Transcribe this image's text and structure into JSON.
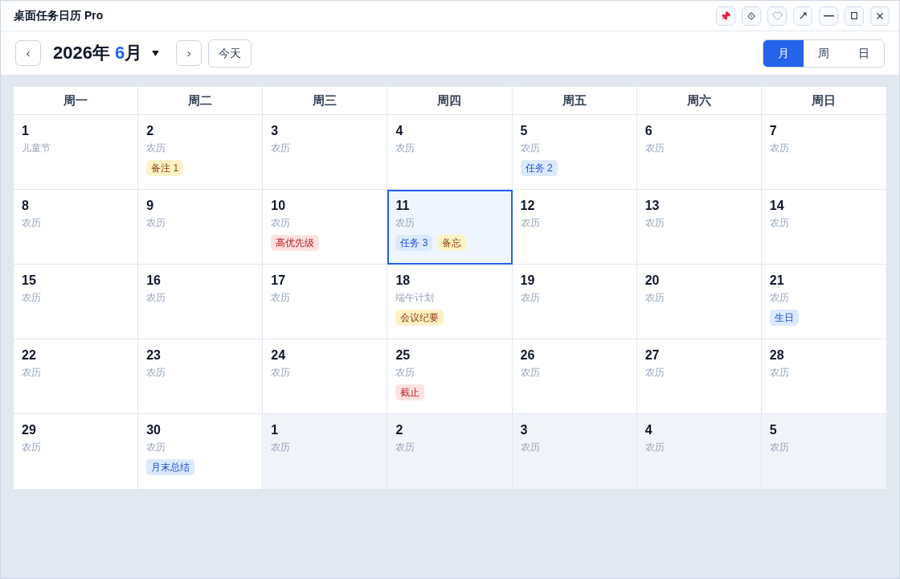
{
  "window": {
    "title": "桌面任务日历 Pro"
  },
  "toolbar": {
    "prev_button": "‹",
    "month_picker": {
      "year": "2026年",
      "month": "6",
      "unit": "月"
    },
    "next_button": "›",
    "today_button": "今天",
    "views": [
      {
        "label": "月",
        "selected": true
      },
      {
        "label": "周",
        "selected": false
      },
      {
        "label": "日",
        "selected": false
      }
    ]
  },
  "calendar": {
    "weekdays": [
      "周一",
      "周二",
      "周三",
      "周四",
      "周五",
      "周六",
      "周日"
    ],
    "weeks": [
      {
        "days": [
          {
            "date": "1",
            "lunar": "儿童节",
            "selected": false,
            "other_month": false
          },
          {
            "date": "2",
            "lunar": "农历",
            "selected": false,
            "other_month": false,
            "events": [
              {
                "label": "备注 1",
                "kind": "note"
              }
            ]
          },
          {
            "date": "3",
            "lunar": "农历",
            "selected": false,
            "other_month": false
          },
          {
            "date": "4",
            "lunar": "农历",
            "selected": false,
            "other_month": false
          },
          {
            "date": "5",
            "lunar": "农历",
            "selected": false,
            "other_month": false,
            "events": [
              {
                "label": "任务 2",
                "kind": "task"
              }
            ]
          },
          {
            "date": "6",
            "lunar": "农历",
            "selected": false,
            "other_month": false
          },
          {
            "date": "7",
            "lunar": "农历",
            "selected": false,
            "other_month": false
          }
        ]
      },
      {
        "days": [
          {
            "date": "8",
            "lunar": "农历",
            "selected": false,
            "other_month": false
          },
          {
            "date": "9",
            "lunar": "农历",
            "selected": false,
            "other_month": false
          },
          {
            "date": "10",
            "lunar": "农历",
            "selected": false,
            "other_month": false,
            "events": [
              {
                "label": "高优先级",
                "kind": "alert"
              }
            ]
          },
          {
            "date": "11",
            "lunar": "农历",
            "selected": true,
            "other_month": false,
            "events": [
              {
                "label": "任务 3",
                "kind": "task"
              },
              {
                "label": "备忘",
                "kind": "note"
              }
            ]
          },
          {
            "date": "12",
            "lunar": "农历",
            "selected": false,
            "other_month": false
          },
          {
            "date": "13",
            "lunar": "农历",
            "selected": false,
            "other_month": false
          },
          {
            "date": "14",
            "lunar": "农历",
            "selected": false,
            "other_month": false
          }
        ]
      },
      {
        "days": [
          {
            "date": "15",
            "lunar": "农历",
            "selected": false,
            "other_month": false
          },
          {
            "date": "16",
            "lunar": "农历",
            "selected": false,
            "other_month": false
          },
          {
            "date": "17",
            "lunar": "农历",
            "selected": false,
            "other_month": false
          },
          {
            "date": "18",
            "lunar": "端午计划",
            "selected": false,
            "other_month": false,
            "events": [
              {
                "label": "会议纪要",
                "kind": "note"
              }
            ]
          },
          {
            "date": "19",
            "lunar": "农历",
            "selected": false,
            "other_month": false
          },
          {
            "date": "20",
            "lunar": "农历",
            "selected": false,
            "other_month": false
          },
          {
            "date": "21",
            "lunar": "农历",
            "selected": false,
            "other_month": false,
            "events": [
              {
                "label": "生日",
                "kind": "task"
              }
            ]
          }
        ]
      },
      {
        "days": [
          {
            "date": "22",
            "lunar": "农历",
            "selected": false,
            "other_month": false
          },
          {
            "date": "23",
            "lunar": "农历",
            "selected": false,
            "other_month": false
          },
          {
            "date": "24",
            "lunar": "农历",
            "selected": false,
            "other_month": false
          },
          {
            "date": "25",
            "lunar": "农历",
            "selected": false,
            "other_month": false,
            "events": [
              {
                "label": "截止",
                "kind": "alert"
              }
            ]
          },
          {
            "date": "26",
            "lunar": "农历",
            "selected": false,
            "other_month": false
          },
          {
            "date": "27",
            "lunar": "农历",
            "selected": false,
            "other_month": false
          },
          {
            "date": "28",
            "lunar": "农历",
            "selected": false,
            "other_month": false
          }
        ]
      },
      {
        "days": [
          {
            "date": "29",
            "lunar": "农历",
            "selected": false,
            "other_month": false
          },
          {
            "date": "30",
            "lunar": "农历",
            "selected": false,
            "other_month": false,
            "events": [
              {
                "label": "月末总结",
                "kind": "task"
              }
            ]
          },
          {
            "date": "1",
            "lunar": "农历",
            "selected": false,
            "other_month": true
          },
          {
            "date": "2",
            "lunar": "农历",
            "selected": false,
            "other_month": true
          },
          {
            "date": "3",
            "lunar": "农历",
            "selected": false,
            "other_month": true
          },
          {
            "date": "4",
            "lunar": "农历",
            "selected": false,
            "other_month": true
          },
          {
            "date": "5",
            "lunar": "农历",
            "selected": false,
            "other_month": true
          }
        ]
      }
    ]
  }
}
